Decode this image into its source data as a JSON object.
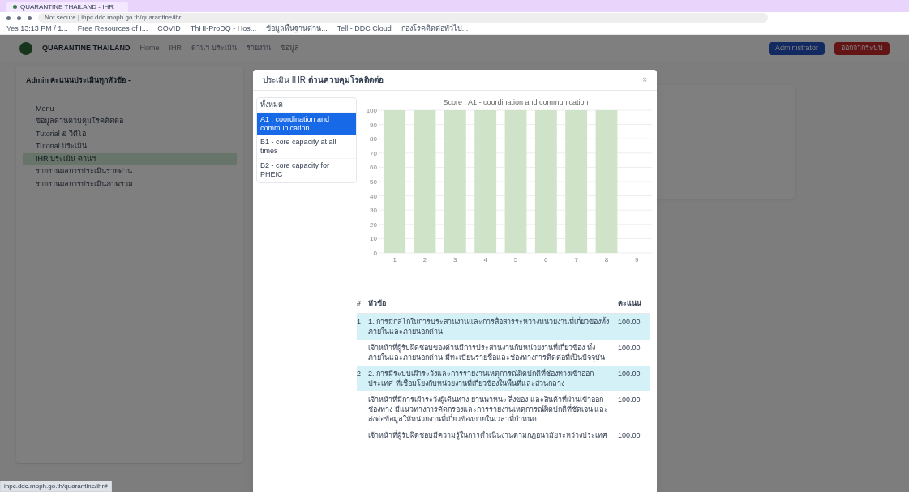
{
  "browser": {
    "tab_title": "QUARANTINE THAILAND - IHR",
    "address": "Not secure | ihpc.ddc.moph.go.th/quarantine/ihr",
    "bookmarks": [
      "Yes 13:13 PM / 1...",
      "Free Resources of I...",
      "COVID",
      "ThHI-ProDQ - Hos...",
      "ข้อมูลพื้นฐานด่าน...",
      "Tell - DDC Cloud",
      "กองโรคติดต่อทั่วไป..."
    ]
  },
  "navbar": {
    "brand": "QUARANTINE THAILAND",
    "links": [
      "Home",
      "IHR",
      "ด่านฯ ประเมิน",
      "รายงาน",
      "ข้อมูล"
    ],
    "buttons": [
      {
        "kind": "user",
        "label": "Administrator"
      },
      {
        "kind": "logout",
        "label": "ออกจากระบบ"
      }
    ]
  },
  "sidebar": {
    "title": "Admin คะแนนประเมินทุกหัวข้อ -",
    "items": [
      {
        "label": "Menu",
        "selected": false
      },
      {
        "label": "ข้อมูลด่านควบคุมโรคติดต่อ",
        "selected": false
      },
      {
        "label": "Tutorial & วิดีโอ",
        "selected": false
      },
      {
        "label": "Tutorial ประเมิน",
        "selected": false
      },
      {
        "label": "IHR ประเมิน ด่านฯ",
        "selected": true
      },
      {
        "label": "รายงานผลการประเมินรายด่าน",
        "selected": false
      },
      {
        "label": "รายงานผลการประเมินภาพรวม",
        "selected": false
      }
    ]
  },
  "modal": {
    "title": "ประเมิน IHR **ด่านควบคุมโรคติดต่อ**",
    "close": "×",
    "tabs": [
      {
        "label": "ทั้งหมด",
        "selected": false
      },
      {
        "label": "A1 : coordination and communication",
        "selected": true
      },
      {
        "label": "B1 - core capacity at all times",
        "selected": false
      },
      {
        "label": "B2 - core capacity for PHEIC",
        "selected": false
      }
    ],
    "chart_data": {
      "type": "bar",
      "title": "Score : A1 - coordination and communication",
      "categories": [
        "1",
        "2",
        "3",
        "4",
        "5",
        "6",
        "7",
        "8",
        "9"
      ],
      "values": [
        100,
        100,
        100,
        100,
        100,
        100,
        100,
        100,
        null
      ],
      "grid": true,
      "ylim": [
        0,
        100
      ],
      "yticks": [
        0,
        10,
        20,
        30,
        40,
        50,
        60,
        70,
        80,
        90,
        100
      ]
    },
    "table": {
      "columns": [
        "#",
        "หัวข้อ",
        "คะแนน"
      ],
      "rows": [
        {
          "kind": "group",
          "number": "1",
          "text": "1. การมีกลไกในการประสานงานและการสื่อสารระหว่างหน่วยงานที่เกี่ยวข้องทั้งภายในและภายนอกด่าน",
          "score": "100.00"
        },
        {
          "kind": "item",
          "text": "เจ้าหน้าที่ผู้รับผิดชอบของด่านมีการประสานงานกับหน่วยงานที่เกี่ยวข้อง ทั้งภายในและภายนอกด่าน มีทะเบียนรายชื่อและช่องทางการติดต่อที่เป็นปัจจุบัน",
          "score": "100.00"
        },
        {
          "kind": "group",
          "number": "2",
          "text": "2. การมีระบบเฝ้าระวังและการรายงานเหตุการณ์ผิดปกติที่ช่องทางเข้าออกประเทศ ที่เชื่อมโยงกับหน่วยงานที่เกี่ยวข้องในพื้นที่และส่วนกลาง",
          "score": "100.00"
        },
        {
          "kind": "item",
          "text": "เจ้าหน้าที่มีการเฝ้าระวังผู้เดินทาง ยานพาหนะ สิ่งของ และสินค้าที่ผ่านเข้าออกช่องทาง มีแนวทางการคัดกรองและการรายงานเหตุการณ์ผิดปกติที่ชัดเจน และส่งต่อข้อมูลให้หน่วยงานที่เกี่ยวข้องภายในเวลาที่กำหนด",
          "score": "100.00"
        },
        {
          "kind": "item",
          "text": "เจ้าหน้าที่ผู้รับผิดชอบมีความรู้ในการดำเนินงานตามกฎอนามัยระหว่างประเทศ",
          "score": "100.00"
        }
      ]
    }
  },
  "status_bar": "ihpc.ddc.moph.go.th/quarantine/ihr#"
}
